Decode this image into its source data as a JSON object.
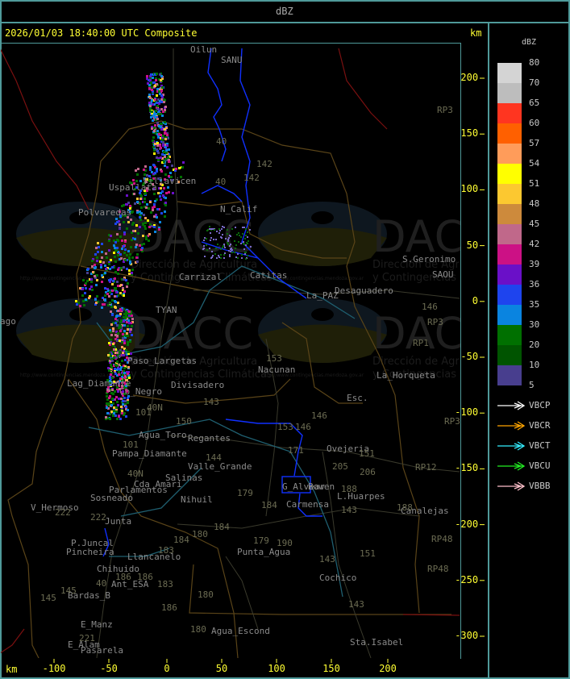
{
  "header": {
    "title": "dBZ"
  },
  "map": {
    "timestamp_title": "2026/01/03 18:40:00 UTC Composite",
    "unit_top": "km",
    "unit_bottom": "km",
    "x_axis": {
      "unit": "km",
      "ticks": [
        "-100",
        "-50",
        "0",
        "50",
        "100",
        "150",
        "200"
      ]
    },
    "y_axis": {
      "unit": "km",
      "ticks": [
        "200",
        "150",
        "100",
        "50",
        "0",
        "-50",
        "-100",
        "-150",
        "-200",
        "-250",
        "-300"
      ]
    },
    "places": [
      "Oilun",
      "SANU",
      "Villavicen",
      "Uspallata",
      "Polvaredas",
      "N_Calif",
      "Carrizal",
      "Catitas",
      "La_PAZ",
      "Desaguadero",
      "S.Geronimo",
      "SAOU",
      "TYAN",
      "ago",
      "Paso_Largetas",
      "Lag_Diamante",
      "Co_Negro",
      "Divisadero",
      "Nacunan",
      "La_Horqueta",
      "Esc.",
      "Agua_Toro",
      "Regantes",
      "Pampa_Diamante",
      "Valle_Grande",
      "Salinas",
      "Cda_Amari",
      "Parlamentos",
      "Sosneado",
      "Nihuil",
      "V_Hermoso",
      "Junta",
      "P.Juncal",
      "Pincheira",
      "Llancanelo",
      "Chihuido",
      "Ant_ESA",
      "Bardas_B",
      "E_Manz",
      "E_Alam",
      "Pasarela",
      "Punta_Agua",
      "Agua_Escond",
      "Carmensa",
      "L.Huarpes",
      "Canalejas",
      "Ovejeria",
      "Cochico",
      "Sta.Isabel",
      "G_Alvear",
      "Bowen"
    ],
    "routes": [
      "40",
      "142",
      "142",
      "40",
      "153",
      "143",
      "146",
      "153",
      "146",
      "150",
      "40N",
      "101",
      "101",
      "40N",
      "144",
      "171",
      "179",
      "184",
      "180",
      "184",
      "184",
      "183",
      "186",
      "186",
      "183",
      "180",
      "186",
      "180",
      "179",
      "190",
      "143",
      "151",
      "151",
      "143",
      "143",
      "205",
      "206",
      "188",
      "188",
      "222",
      "222",
      "145",
      "145",
      "40",
      "221",
      "RP3",
      "RP3",
      "RP1",
      "146",
      "RP3",
      "RP12",
      "RP48",
      "RP48"
    ],
    "watermark": {
      "brand": "DACC",
      "line1": "Dirección de Agricultura",
      "line2": "y Contingencias Climáticas",
      "url": "http://www.contingencias.mendoza.gov.ar"
    }
  },
  "legend": {
    "title": "dBZ",
    "scale": [
      {
        "label": "80",
        "color": "#d4d4d4"
      },
      {
        "label": "70",
        "color": "#bdbdbd"
      },
      {
        "label": "65",
        "color": "#ff3520"
      },
      {
        "label": "60",
        "color": "#ff6000"
      },
      {
        "label": "57",
        "color": "#ff9c5a"
      },
      {
        "label": "54",
        "color": "#ffff00"
      },
      {
        "label": "51",
        "color": "#fcc830"
      },
      {
        "label": "48",
        "color": "#cd8a3c"
      },
      {
        "label": "45",
        "color": "#c0688a"
      },
      {
        "label": "42",
        "color": "#cc1185"
      },
      {
        "label": "39",
        "color": "#6a10c8"
      },
      {
        "label": "36",
        "color": "#1e44ee"
      },
      {
        "label": "35",
        "color": "#0a84e0"
      },
      {
        "label": "30",
        "color": "#007000"
      },
      {
        "label": "20",
        "color": "#005400"
      },
      {
        "label": "10",
        "color": "#483e8e"
      }
    ],
    "bottom_label": "5",
    "radars": [
      {
        "label": "VBCP",
        "color": "#ffffff"
      },
      {
        "label": "VBCR",
        "color": "#ffa500"
      },
      {
        "label": "VBCT",
        "color": "#33eeff"
      },
      {
        "label": "VBCU",
        "color": "#22ee22"
      },
      {
        "label": "VBBB",
        "color": "#ffc0cb"
      }
    ]
  }
}
